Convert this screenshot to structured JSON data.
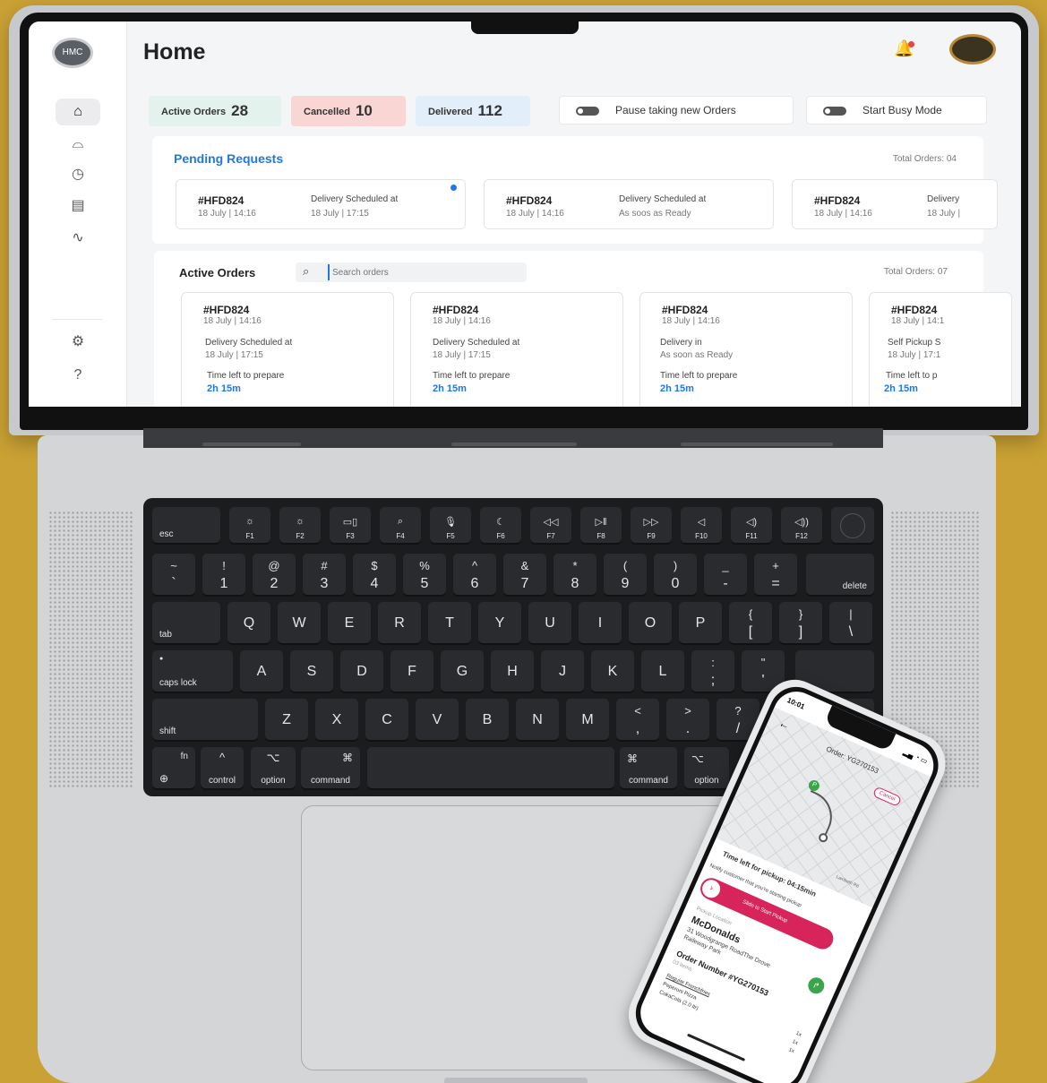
{
  "app": {
    "page_title": "Home",
    "logo_text": "HMC",
    "stats": [
      {
        "label": "Active Orders",
        "value": "28"
      },
      {
        "label": "Cancelled",
        "value": "10"
      },
      {
        "label": "Delivered",
        "value": "112"
      }
    ],
    "toggles": {
      "pause": "Pause taking new Orders",
      "busy": "Start Busy Mode"
    },
    "pending": {
      "title": "Pending Requests",
      "total": "Total Orders: 04",
      "cards": [
        {
          "id": "#HFD824",
          "date": "18 July | 14:16",
          "label": "Delivery Scheduled at",
          "value": "18 July | 17:15"
        },
        {
          "id": "#HFD824",
          "date": "18 July | 14:16",
          "label": "Delivery Scheduled at",
          "value": "As soos as Ready"
        },
        {
          "id": "#HFD824",
          "date": "18 July | 14:16",
          "label": "Delivery",
          "value": "18 July |"
        }
      ]
    },
    "active": {
      "title": "Active Orders",
      "search_placeholder": "Search orders",
      "total": "Total Orders: 07",
      "cards": [
        {
          "id": "#HFD824",
          "date": "18 July | 14:16",
          "label": "Delivery Scheduled at",
          "value": "18 July | 17:15",
          "time_label": "Time left to prepare",
          "time": "2h 15m"
        },
        {
          "id": "#HFD824",
          "date": "18 July | 14:16",
          "label": "Delivery Scheduled at",
          "value": "18 July | 17:15",
          "time_label": "Time left to prepare",
          "time": "2h 15m"
        },
        {
          "id": "#HFD824",
          "date": "18 July | 14:16",
          "label": "Delivery in",
          "value": "As soon as Ready",
          "time_label": "Time left to prepare",
          "time": "2h 15m"
        },
        {
          "id": "#HFD824",
          "date": "18 July | 14:1",
          "label": "Self Pickup S",
          "value": "18 July | 17:1",
          "time_label": "Time left to p",
          "time": "2h 15m"
        }
      ]
    }
  },
  "keyboard": {
    "esc": "esc",
    "fkeys": [
      "F1",
      "F2",
      "F3",
      "F4",
      "F5",
      "F6",
      "F7",
      "F8",
      "F9",
      "F10",
      "F11",
      "F12"
    ],
    "fkey_icons": [
      "☼",
      "☼",
      "▭▯",
      "⌕",
      "🎙",
      "☾",
      "◁◁",
      "▷‖",
      "▷▷",
      "◁",
      "◁)",
      "◁))"
    ],
    "row1": [
      [
        "~",
        "`"
      ],
      [
        "!",
        "1"
      ],
      [
        "@",
        "2"
      ],
      [
        "#",
        "3"
      ],
      [
        "$",
        "4"
      ],
      [
        "%",
        "5"
      ],
      [
        "^",
        "6"
      ],
      [
        "&",
        "7"
      ],
      [
        "*",
        "8"
      ],
      [
        "(",
        "9"
      ],
      [
        ")",
        "0"
      ],
      [
        "_",
        "-"
      ],
      [
        "+",
        "="
      ]
    ],
    "delete": "delete",
    "tab": "tab",
    "row2": [
      "Q",
      "W",
      "E",
      "R",
      "T",
      "Y",
      "U",
      "I",
      "O",
      "P"
    ],
    "row2b": [
      [
        "{",
        "["
      ],
      [
        "}",
        "]"
      ],
      [
        "|",
        "\\"
      ]
    ],
    "caps": "caps lock",
    "row3": [
      "A",
      "S",
      "D",
      "F",
      "G",
      "H",
      "J",
      "K",
      "L"
    ],
    "row3b": [
      [
        ":",
        ";"
      ],
      [
        "\"",
        "'"
      ]
    ],
    "shift": "shift",
    "row4": [
      "Z",
      "X",
      "C",
      "V",
      "B",
      "N",
      "M"
    ],
    "row4b": [
      [
        "<",
        ","
      ],
      [
        ">",
        "."
      ],
      [
        "?",
        "/"
      ]
    ],
    "fn": "fn",
    "control": "control",
    "option": "option",
    "command": "command",
    "control_sym": "^",
    "option_sym": "⌥",
    "command_sym": "⌘",
    "globe": "⊕",
    "left": "◀"
  },
  "phone": {
    "time": "10:01",
    "order_title": "Order: YG270153",
    "cancel": "Cancel",
    "time_left": "Time left for pickup: 04:15min",
    "notify": "Notify customer that you're starting pickup",
    "slide": "Slide to Start Pickup",
    "pickup_label": "Pickup Location",
    "restaurant": "McDonalds",
    "address1": "31 Woodgrange RoadThe Drove",
    "address2": "Raileway Park",
    "order_number": "Order Number #YG270153",
    "items_count": "03 items",
    "items": [
      {
        "name": "Regular Frenchfries",
        "qty": "1x"
      },
      {
        "name": "Peperoni Pizza",
        "qty": "1x"
      },
      {
        "name": "CokaCola (2.0 ltr)",
        "qty": "1x"
      }
    ],
    "map_label": "Lambeth Rd"
  },
  "colors": {
    "active": "#e3f2ec",
    "cancelled": "#f9d5d3",
    "delivered": "#e3eefb",
    "accent": "#2277e6",
    "phone_accent": "#d7245a"
  }
}
